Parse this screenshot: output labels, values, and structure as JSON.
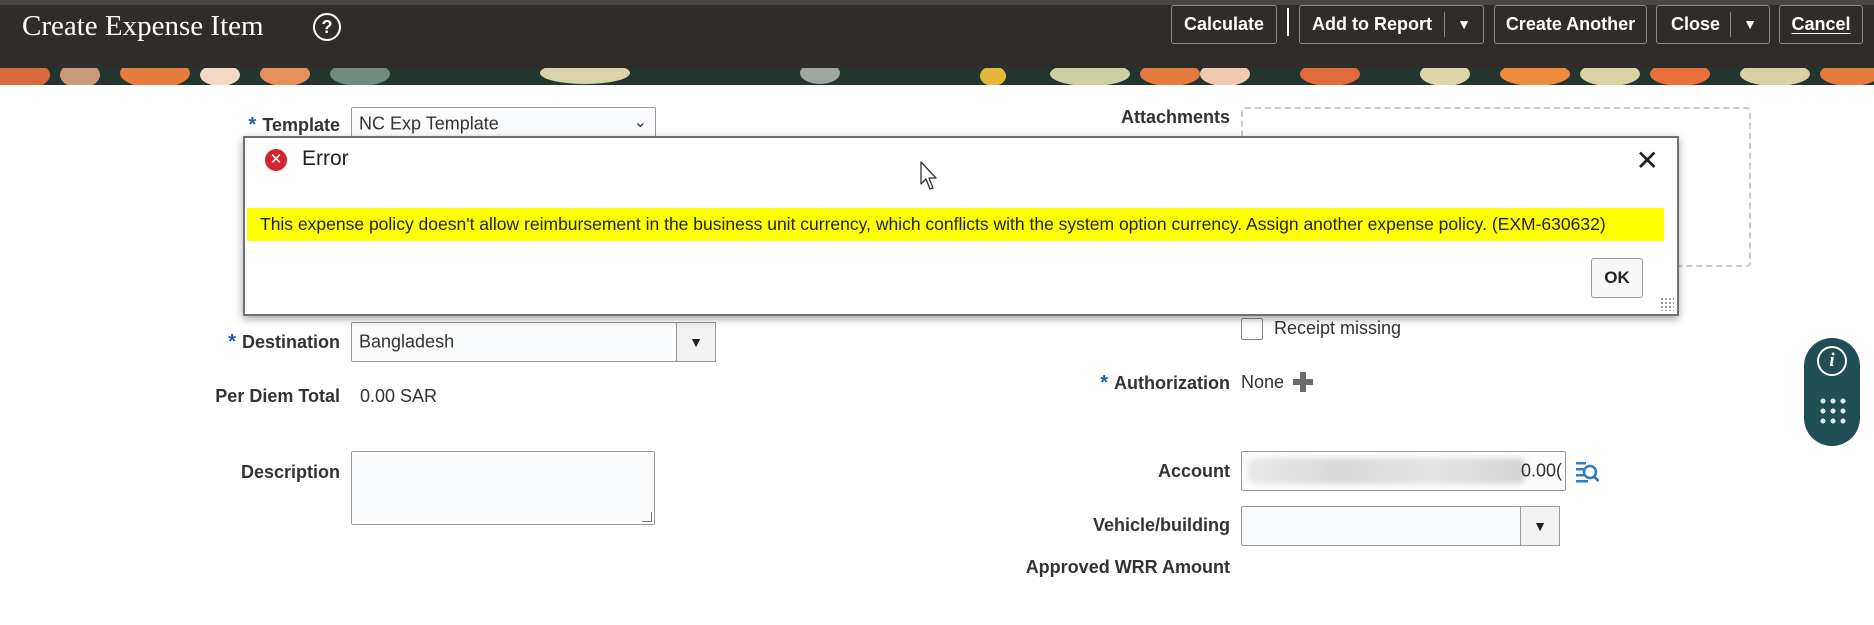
{
  "header": {
    "title": "Create Expense Item",
    "buttons": {
      "calculate": "Calculate",
      "add_to_report": "Add to Report",
      "create_another": "Create Another",
      "close": "Close",
      "cancel": "Cancel"
    }
  },
  "form": {
    "template_label": "Template",
    "template_value": "NC Exp Template",
    "destination_label": "Destination",
    "destination_value": "Bangladesh",
    "per_diem_label": "Per Diem Total",
    "per_diem_value": "0.00 SAR",
    "description_label": "Description",
    "description_value": "",
    "attachments_label": "Attachments",
    "receipt_missing_label": "Receipt missing",
    "authorization_label": "Authorization",
    "authorization_value": "None",
    "account_label": "Account",
    "account_value": "0.00(",
    "vehicle_label": "Vehicle/building",
    "vehicle_value": "",
    "approved_wrr_label": "Approved WRR Amount"
  },
  "dialog": {
    "title": "Error",
    "message": "This expense policy doesn't allow reimbursement in the business unit currency, which conflicts with the system option currency. Assign another expense policy. (EXM-630632)",
    "ok_label": "OK"
  },
  "colors": {
    "header_bg": "#2f2c29",
    "highlight": "#ffff00",
    "error_red": "#d1242f",
    "required_blue": "#1d5fa8",
    "info_widget": "#1f4f55"
  }
}
